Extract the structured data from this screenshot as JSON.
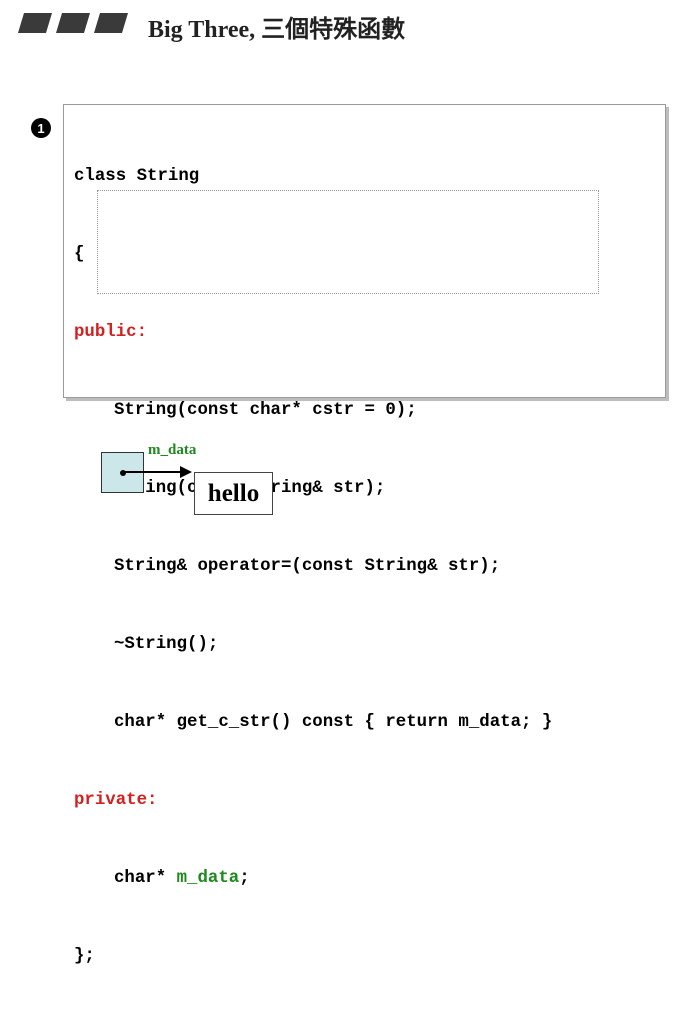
{
  "slide": {
    "title": "Big Three, 三個特殊函數",
    "badge": "1",
    "icons": [
      "title-bars-icon"
    ]
  },
  "code": {
    "line1": "class String",
    "line2": "{",
    "public_kw": "public:",
    "ctor1": "String(const char* cstr = 0);",
    "ctor2": "String(const String& str);",
    "assign_op": "String& operator=(const String& str);",
    "dtor": "~String();",
    "getter": "char* get_c_str() const { return m_data; }",
    "private_kw": "private:",
    "member_type": "char* ",
    "member_name": "m_data",
    "member_end": ";",
    "close": "};"
  },
  "diagram": {
    "pointer_label": "m_data",
    "string_value": "hello"
  },
  "colors": {
    "keyword_red": "#d42020",
    "identifier_green": "#1e8a1e",
    "pointer_box_fill": "#cbe7ea"
  }
}
